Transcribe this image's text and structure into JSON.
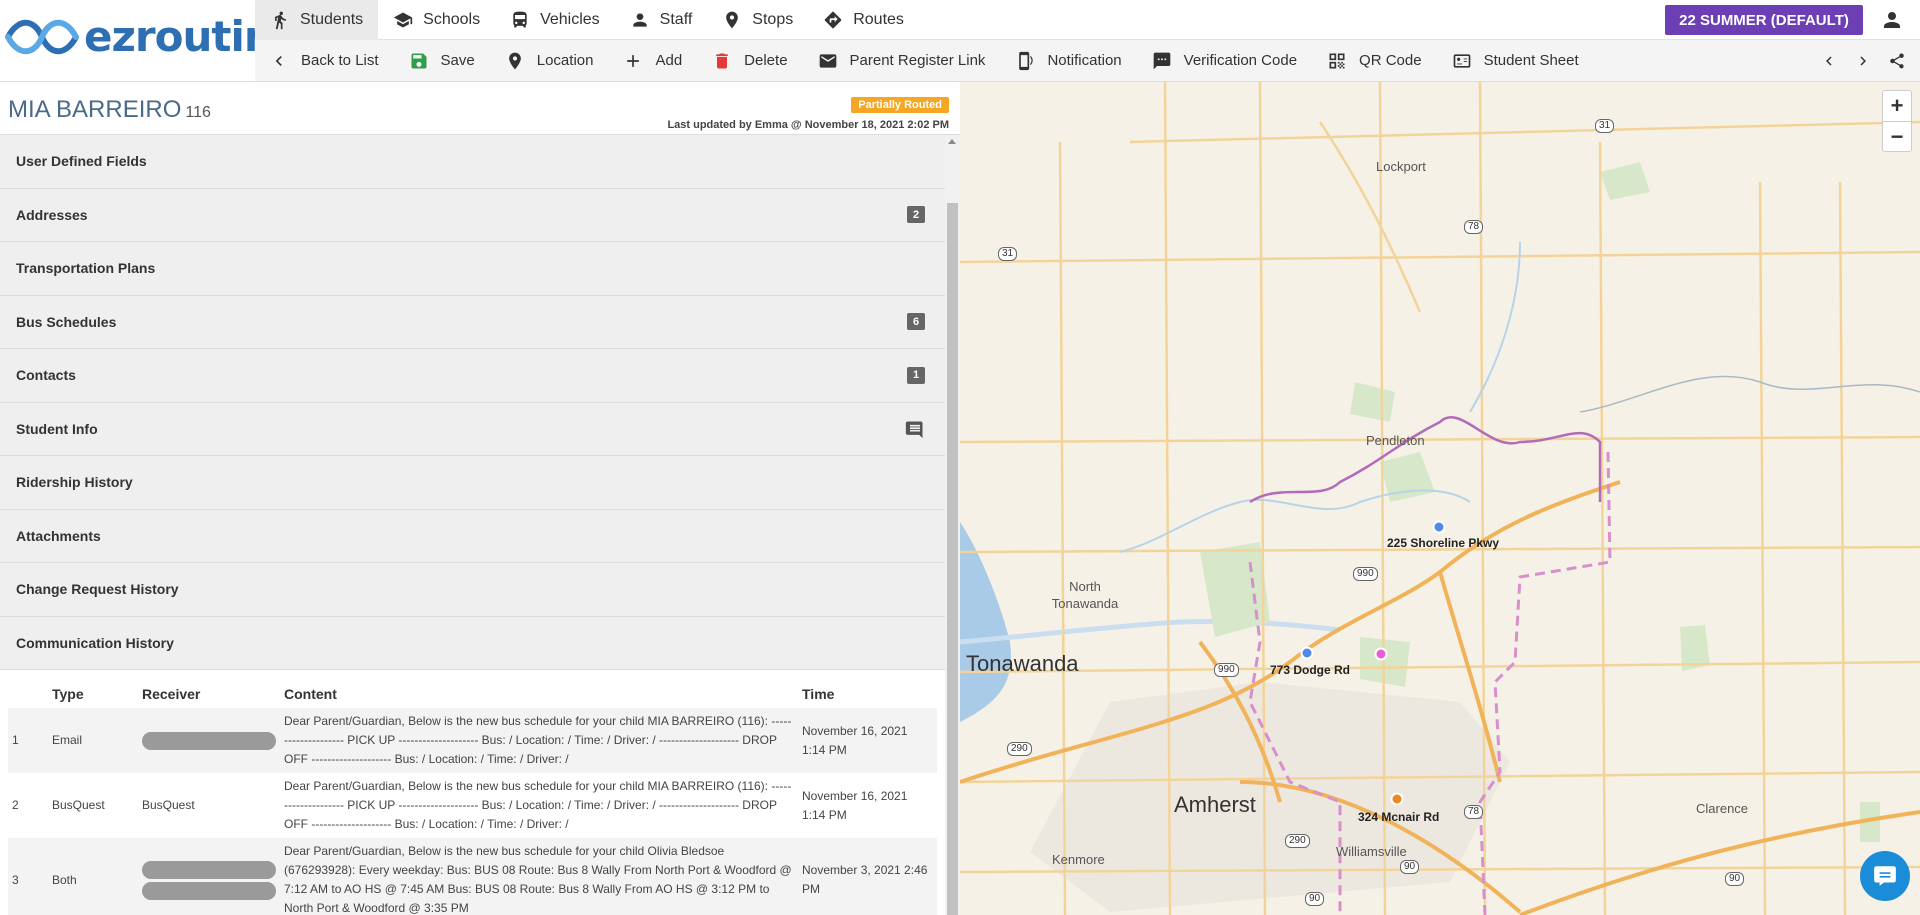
{
  "logo": {
    "text": "ezrouting"
  },
  "nav": {
    "tabs": [
      {
        "label": "Students",
        "icon": "walking-person-icon",
        "active": true
      },
      {
        "label": "Schools",
        "icon": "graduation-cap-icon"
      },
      {
        "label": "Vehicles",
        "icon": "bus-icon"
      },
      {
        "label": "Staff",
        "icon": "person-icon"
      },
      {
        "label": "Stops",
        "icon": "map-pin-icon"
      },
      {
        "label": "Routes",
        "icon": "diamond-direction-icon"
      }
    ],
    "season": "22 SUMMER (DEFAULT)",
    "season_color": "#6c3fb5"
  },
  "toolbar": {
    "back": "Back to List",
    "save": "Save",
    "location": "Location",
    "add": "Add",
    "delete": "Delete",
    "parent_register": "Parent Register Link",
    "notification": "Notification",
    "verification": "Verification Code",
    "qr": "QR Code",
    "student_sheet": "Student Sheet"
  },
  "student": {
    "name": "MIA BARREIRO",
    "id": "116",
    "status": "Partially Routed",
    "status_color": "#f5a623",
    "updated": "Last updated by Emma @ November 18, 2021 2:02 PM"
  },
  "sections": {
    "user_defined": "User Defined Fields",
    "addresses": "Addresses",
    "addresses_count": "2",
    "transport_plans": "Transportation Plans",
    "bus_schedules": "Bus Schedules",
    "bus_schedules_count": "6",
    "contacts": "Contacts",
    "contacts_count": "1",
    "student_info": "Student Info",
    "ridership": "Ridership History",
    "attachments": "Attachments",
    "change_request": "Change Request History",
    "communication": "Communication History"
  },
  "comm_table": {
    "headers": {
      "type": "Type",
      "receiver": "Receiver",
      "content": "Content",
      "time": "Time"
    },
    "rows": [
      {
        "num": "1",
        "type": "Email",
        "receiver": "",
        "content": "Dear Parent/Guardian, Below is the new bus schedule for your child MIA BARREIRO (116): -------------------- PICK UP -------------------- Bus: / Location: / Time: / Driver: / -------------------- DROP OFF -------------------- Bus: / Location: / Time: / Driver: /",
        "time": "November 16, 2021 1:14 PM"
      },
      {
        "num": "2",
        "type": "BusQuest",
        "receiver": "BusQuest",
        "content": "Dear Parent/Guardian, Below is the new bus schedule for your child MIA BARREIRO (116): -------------------- PICK UP -------------------- Bus: / Location: / Time: / Driver: / -------------------- DROP OFF -------------------- Bus: / Location: / Time: / Driver: /",
        "time": "November 16, 2021 1:14 PM"
      },
      {
        "num": "3",
        "type": "Both",
        "receiver": "",
        "content": "Dear Parent/Guardian, Below is the new bus schedule for your child Olivia Bledsoe (676293928): Every weekday: Bus: BUS 08 Route: Bus 8 Wally From North Port & Woodford @ 7:12 AM to AO HS @ 7:45 AM Bus: BUS 08 Route: Bus 8 Wally From AO HS @ 3:12 PM to North Port & Woodford @ 3:35 PM",
        "time": "November 3, 2021 2:46 PM"
      }
    ]
  },
  "map": {
    "places": {
      "lockport": "Lockport",
      "pendleton": "Pendleton",
      "north_tonawanda": "North Tonawanda",
      "tonawanda": "Tonawanda",
      "amherst": "Amherst",
      "williamsville": "Williamsville",
      "kenmore": "Kenmore",
      "clarence": "Clarence"
    },
    "addresses": {
      "a1": "225 Shoreline Pkwy",
      "a2": "773 Dodge Rd",
      "a3": "324 Mcnair Rd"
    },
    "shields": {
      "s31a": "31",
      "s31b": "31",
      "s78a": "78",
      "s78b": "78",
      "s990a": "990",
      "s990b": "990",
      "s290a": "290",
      "s290b": "290",
      "s90a": "90",
      "s90b": "90",
      "s90c": "90"
    },
    "zoom_in": "+",
    "zoom_out": "−"
  }
}
